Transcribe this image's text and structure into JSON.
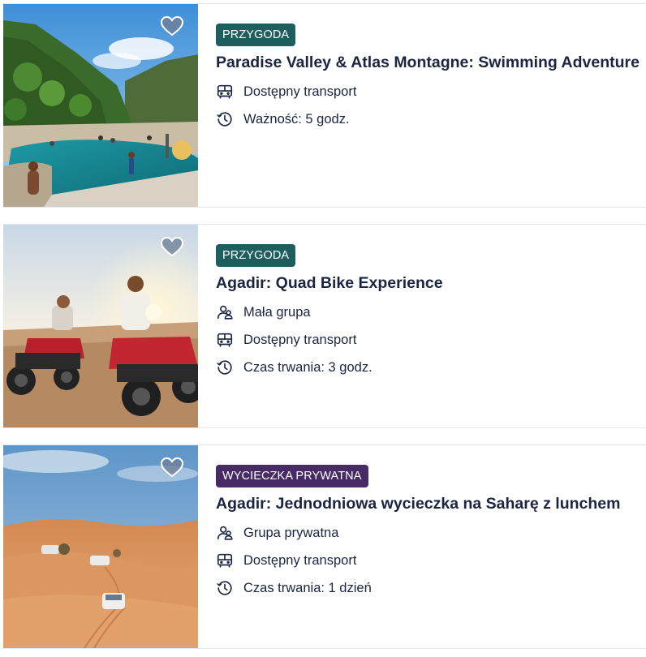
{
  "cards": [
    {
      "badge": "PRZYGODA",
      "badge_color": "#1f5e5f",
      "title": "Paradise Valley & Atlas Montagne: Swimming Adventure",
      "features": [
        {
          "icon": "bus-icon",
          "label": "Dostępny transport"
        },
        {
          "icon": "duration-clock-icon",
          "label": "Ważność: 5 godz."
        }
      ],
      "image": "river-canyon-photo"
    },
    {
      "badge": "PRZYGODA",
      "badge_color": "#1f5e5f",
      "title": "Agadir: Quad Bike Experience",
      "features": [
        {
          "icon": "group-icon",
          "label": "Mała grupa"
        },
        {
          "icon": "bus-icon",
          "label": "Dostępny transport"
        },
        {
          "icon": "duration-clock-icon",
          "label": "Czas trwania: 3 godz."
        }
      ],
      "image": "quad-bike-photo"
    },
    {
      "badge": "WYCIECZKA PRYWATNA",
      "badge_color": "#472a66",
      "title": "Agadir: Jednodniowa wycieczka na Saharę z lunchem",
      "features": [
        {
          "icon": "group-icon",
          "label": "Grupa prywatna"
        },
        {
          "icon": "bus-icon",
          "label": "Dostępny transport"
        },
        {
          "icon": "duration-clock-icon",
          "label": "Czas trwania: 1 dzień"
        }
      ],
      "image": "desert-dunes-photo"
    }
  ]
}
